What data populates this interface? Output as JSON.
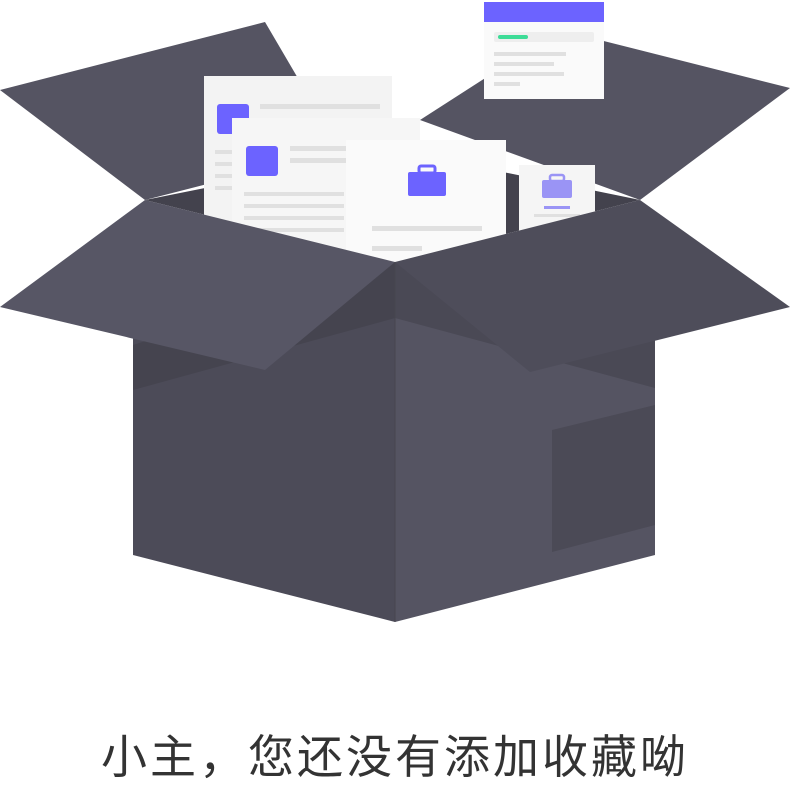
{
  "empty_state": {
    "message": "小主，您还没有添加收藏呦",
    "illustration_icon": "open-box-with-documents-icon"
  },
  "colors": {
    "box_dark": "#4c4b58",
    "box_mid": "#555462",
    "box_shadow": "#45444f",
    "accent": "#6c63ff",
    "accent_light": "#9a94f5",
    "green_accent": "#3ddc97",
    "paper": "#f7f7f7",
    "paper_line": "#e4e4e4",
    "text": "#333333"
  }
}
